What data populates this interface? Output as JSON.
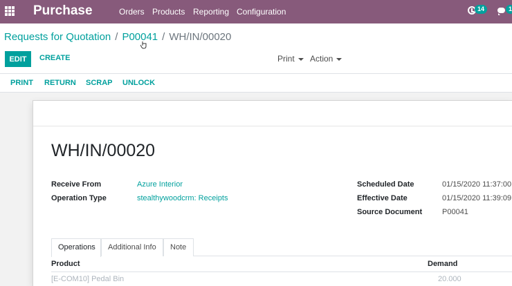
{
  "navbar": {
    "brand": "Purchase",
    "menu": [
      "Orders",
      "Products",
      "Reporting",
      "Configuration"
    ],
    "activity_count": "14",
    "message_count": "1",
    "bg_color": "#875a7b"
  },
  "breadcrumb": {
    "root": "Requests for Quotation",
    "parent": "P00041",
    "current": "WH/IN/00020"
  },
  "control": {
    "edit_label": "EDIT",
    "create_label": "CREATE",
    "print_label": "Print",
    "action_label": "Action"
  },
  "statusbar": {
    "buttons": [
      "PRINT",
      "RETURN",
      "SCRAP",
      "UNLOCK"
    ]
  },
  "record": {
    "title": "WH/IN/00020",
    "receive_from_label": "Receive From",
    "receive_from": "Azure Interior",
    "operation_type_label": "Operation Type",
    "operation_type": "stealthywoodcrm: Receipts",
    "scheduled_date_label": "Scheduled Date",
    "scheduled_date": "01/15/2020 11:37:00",
    "effective_date_label": "Effective Date",
    "effective_date": "01/15/2020 11:39:09",
    "source_document_label": "Source Document",
    "source_document": "P00041"
  },
  "tabs": [
    "Operations",
    "Additional Info",
    "Note"
  ],
  "table": {
    "headers": [
      "Product",
      "Demand"
    ],
    "rows": [
      {
        "product": "[E-COM10] Pedal Bin",
        "demand": "20.000"
      }
    ]
  },
  "accent_color": "#00a09d"
}
